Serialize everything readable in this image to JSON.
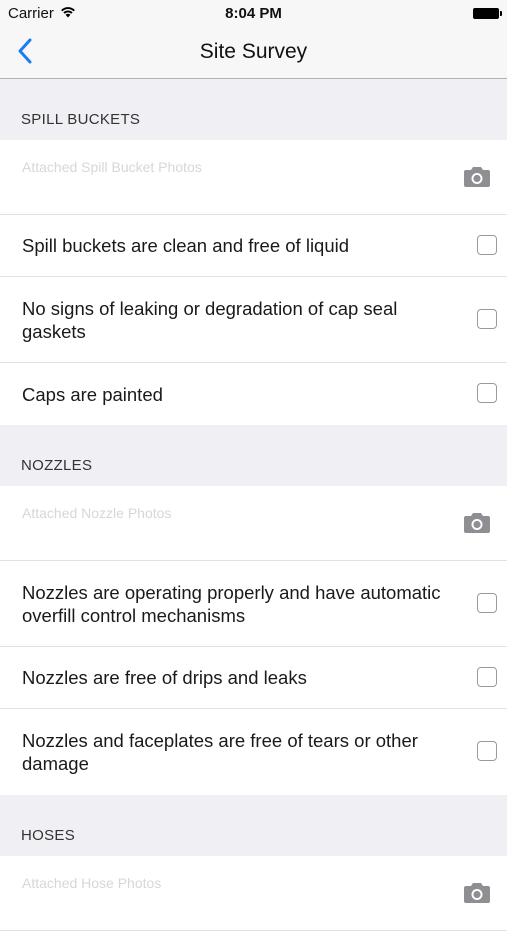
{
  "status": {
    "carrier": "Carrier",
    "time": "8:04 PM"
  },
  "nav": {
    "title": "Site Survey"
  },
  "sections": [
    {
      "header": "SPILL BUCKETS",
      "photo_placeholder": "Attached Spill Bucket Photos",
      "items": [
        {
          "label": "Spill buckets are clean and free of liquid"
        },
        {
          "label": "No signs of leaking or degradation of cap seal gaskets"
        },
        {
          "label": "Caps are painted"
        }
      ]
    },
    {
      "header": "NOZZLES",
      "photo_placeholder": "Attached Nozzle Photos",
      "items": [
        {
          "label": "Nozzles are operating properly and have automatic overfill control mechanisms"
        },
        {
          "label": "Nozzles are free of drips and leaks"
        },
        {
          "label": "Nozzles and faceplates are free of tears or other damage"
        }
      ]
    },
    {
      "header": "HOSES",
      "photo_placeholder": "Attached Hose Photos"
    }
  ],
  "colors": {
    "accent": "#1a7cf5",
    "background": "#efeff4"
  }
}
